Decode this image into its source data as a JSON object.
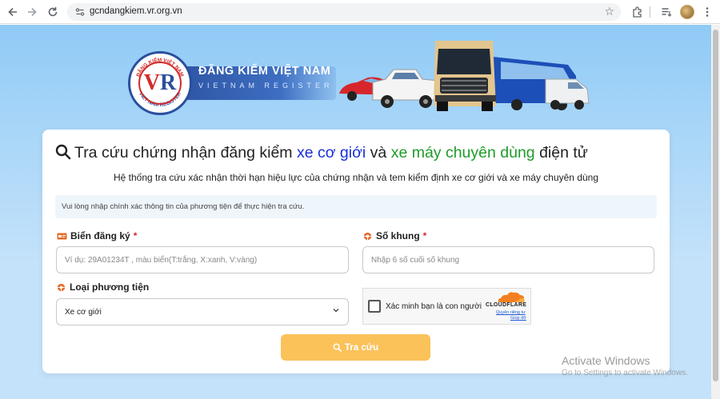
{
  "browser": {
    "url": "gcndangkiem.vr.org.vn",
    "icons": [
      "back-icon",
      "forward-icon",
      "reload-icon",
      "site-info-icon",
      "star-icon",
      "extensions-icon",
      "reading-list-icon",
      "profile-avatar",
      "more-menu-icon"
    ]
  },
  "banner": {
    "logo_ring_text": "ĐĂNG KIỂM VIỆT NAM · VIET NAM REGISTER",
    "brand_title": "ĐĂNG KIỂM VIỆT NAM",
    "brand_subtitle": "VIETNAM REGISTER"
  },
  "form": {
    "heading_part1": "Tra cứu chứng nhận đăng kiểm",
    "heading_part2": "xe cơ giới",
    "heading_part3": "và",
    "heading_part4": "xe máy chuyên dùng",
    "heading_part5": "điện tử",
    "subheading": "Hệ thống tra cứu xác nhận thời hạn hiệu lực của chứng nhận và tem kiểm định xe cơ giới và xe máy chuyên dùng",
    "notice": "Vui lòng nhập chính xác thông tin của phương tiện để thực hiện tra cứu.",
    "plate_label": "Biển đăng ký",
    "plate_placeholder": "Ví dụ: 29A01234T , màu biển(T:trắng, X:xanh, V:vàng)",
    "chassis_label": "Số khung",
    "chassis_placeholder": "Nhập 6 số cuối số khung",
    "required_mark": "*",
    "vehicle_type_label": "Loại phương tiện",
    "vehicle_type_value": "Xe cơ giới",
    "captcha_text": "Xác minh bạn là con người",
    "captcha_brand": "CLOUDFLARE",
    "captcha_link_privacy": "Quyền riêng tư",
    "captcha_link_help": "Giúp đỡ",
    "submit_label": "Tra cứu"
  },
  "colors": {
    "heading_blue": "#1a2fd6",
    "heading_green": "#1f9c2a",
    "submit_bg": "#fbc25a",
    "required": "#d42b2b"
  },
  "os_overlay": {
    "title": "Activate Windows",
    "subtitle": "Go to Settings to activate Windows."
  }
}
